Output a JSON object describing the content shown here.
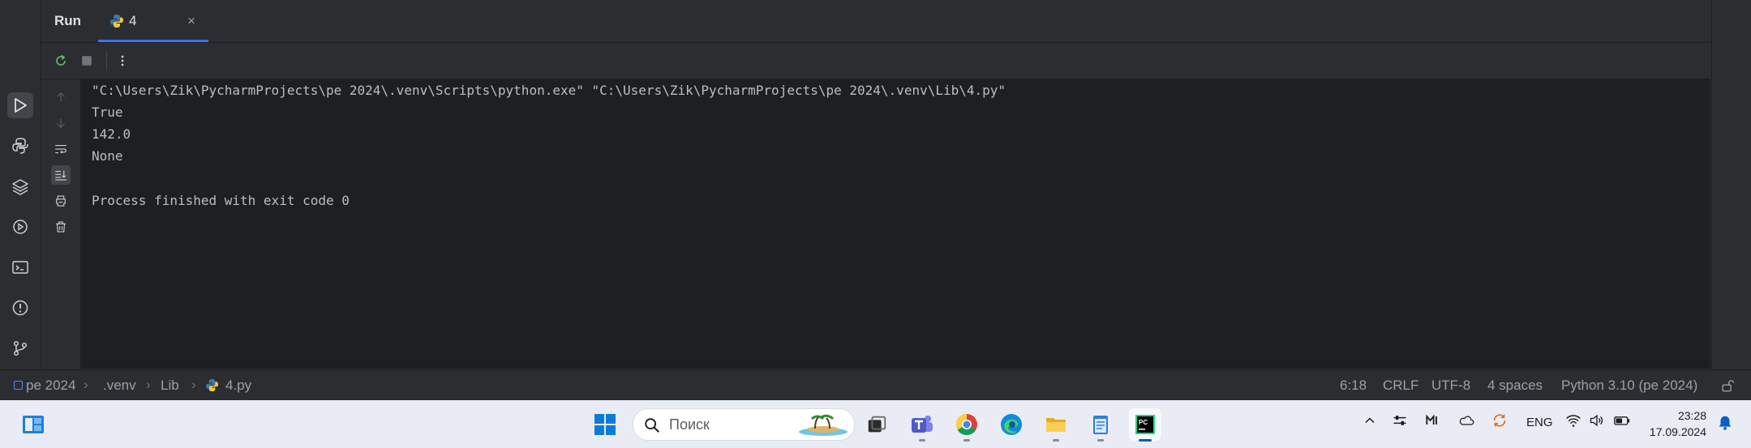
{
  "toolwindow": {
    "title": "Run",
    "tab_label": "4",
    "tab_close": "×"
  },
  "console": {
    "lines": [
      "\"C:\\Users\\Zik\\PycharmProjects\\pe 2024\\.venv\\Scripts\\python.exe\" \"C:\\Users\\Zik\\PycharmProjects\\pe 2024\\.venv\\Lib\\4.py\"",
      "True",
      "142.0",
      "None",
      "",
      "Process finished with exit code 0"
    ]
  },
  "breadcrumbs": [
    "pe 2024",
    ".venv",
    "Lib",
    "4.py"
  ],
  "status": {
    "position": "6:18",
    "line_separator": "CRLF",
    "encoding": "UTF-8",
    "indent": "4 spaces",
    "interpreter": "Python 3.10 (pe 2024)"
  },
  "taskbar": {
    "search_placeholder": "Поиск",
    "language": "ENG",
    "time": "23:28",
    "date": "17.09.2024"
  },
  "colors": {
    "accent": "#3574f0",
    "console_bg": "#1e1f22",
    "panel_bg": "#2b2d30",
    "taskbar_bg": "#e9ecf4"
  },
  "icons": {
    "activity": [
      "run-icon",
      "python-console-icon",
      "layers-icon",
      "services-icon",
      "terminal-icon",
      "problems-icon",
      "git-icon"
    ],
    "toolbar": [
      "rerun-icon",
      "stop-icon",
      "more-icon"
    ],
    "gutter": [
      "up-arrow-icon",
      "down-arrow-icon",
      "soft-wrap-icon",
      "scroll-to-end-icon",
      "print-icon",
      "trash-icon"
    ]
  }
}
